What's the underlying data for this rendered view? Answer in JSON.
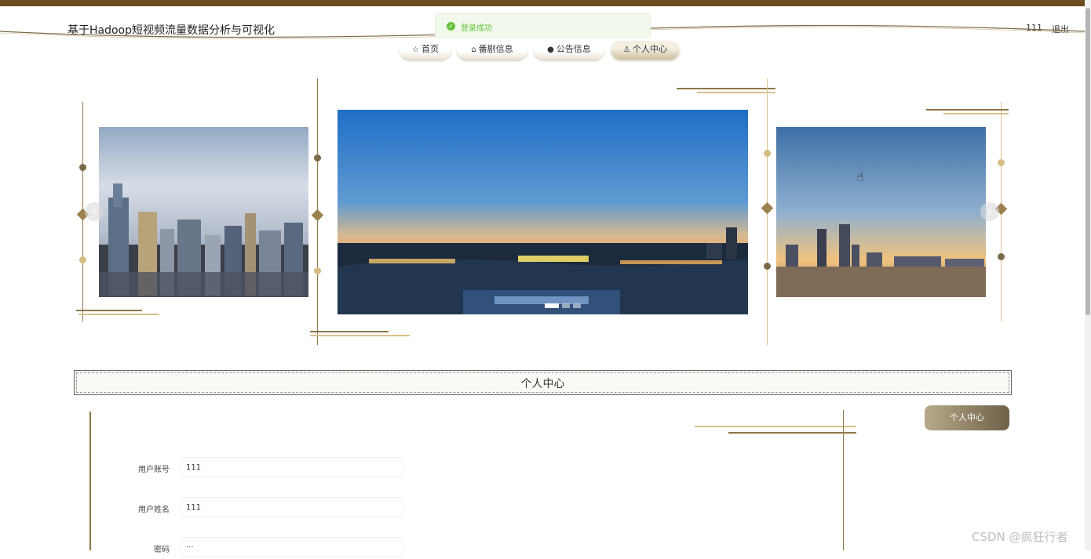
{
  "header": {
    "title": "基于Hadoop短视频流量数据分析与可视化",
    "user": "111",
    "logout": "退出"
  },
  "toast": {
    "message": "登录成功"
  },
  "nav": [
    {
      "label": "首页",
      "icon": "star-icon"
    },
    {
      "label": "番剧信息",
      "icon": "bag-icon"
    },
    {
      "label": "公告信息",
      "icon": "info-icon"
    },
    {
      "label": "个人中心",
      "icon": "user-icon"
    }
  ],
  "section": {
    "title": "个人中心"
  },
  "side_button": {
    "label": "个人中心"
  },
  "form": {
    "account_label": "用户账号",
    "account_value": "111",
    "name_label": "用户姓名",
    "name_value": "111",
    "password_label": "密码",
    "password_value": "···"
  },
  "watermark": "CSDN @疯狂行者",
  "colors": {
    "accent": "#6b4c1c",
    "gold": "#d6bc82",
    "success": "#67c23a"
  }
}
